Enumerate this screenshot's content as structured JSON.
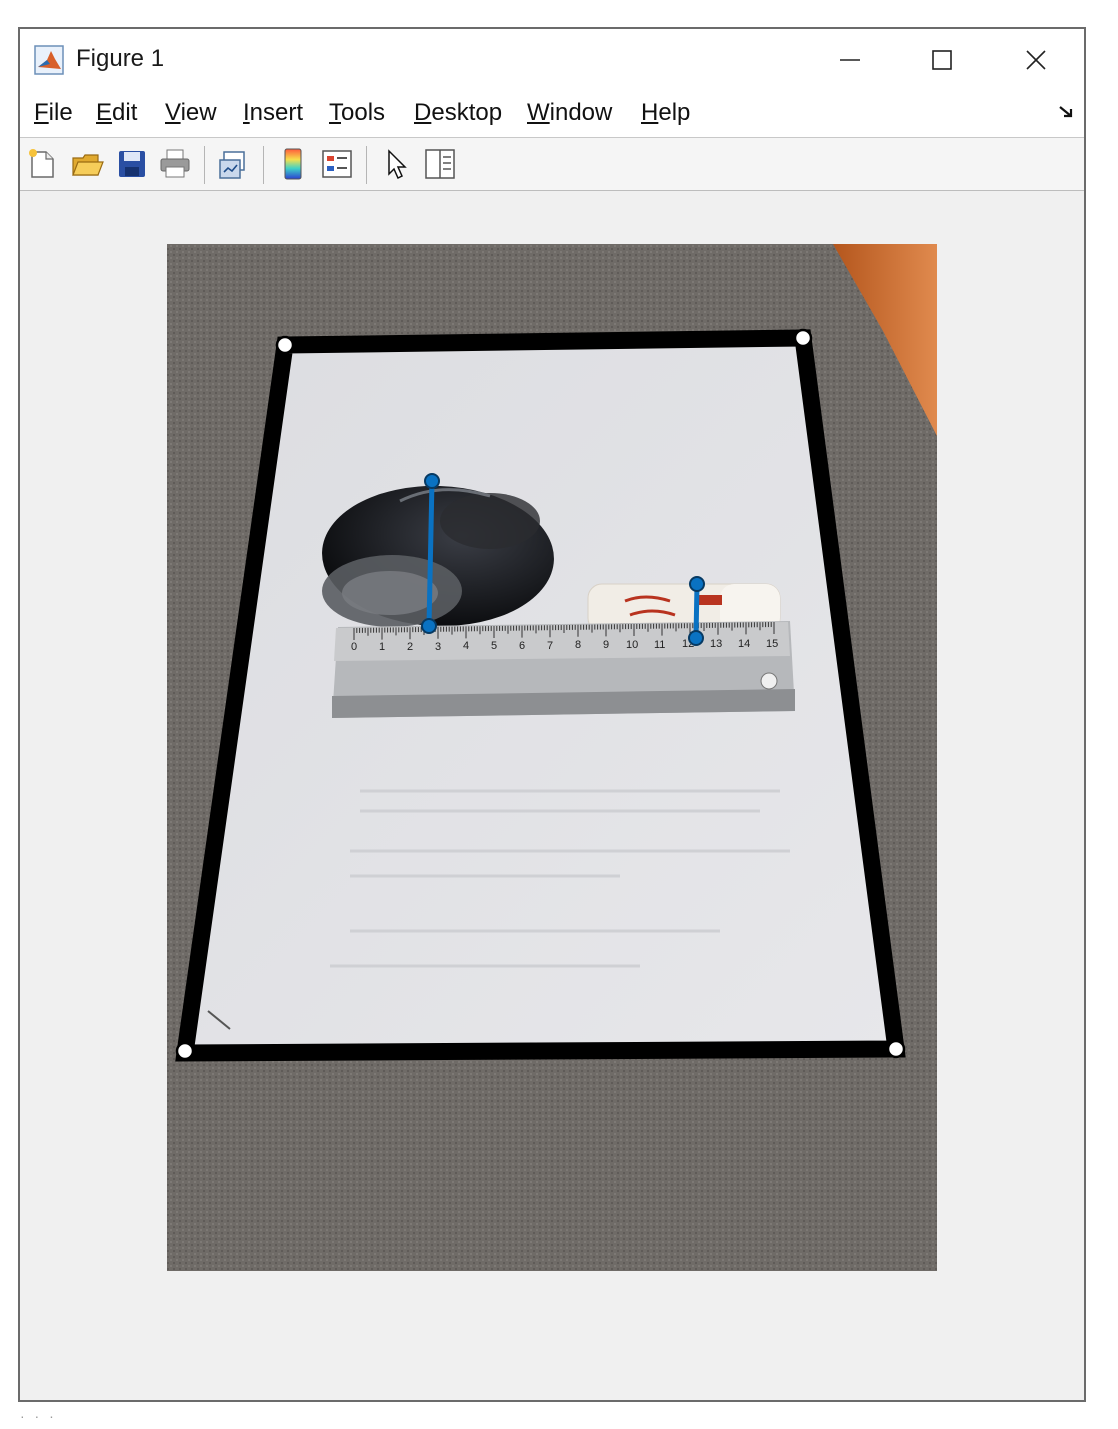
{
  "window": {
    "title": "Figure 1",
    "controls": {
      "minimize": "—",
      "maximize": "☐",
      "close": "✕"
    }
  },
  "menu": {
    "items": [
      {
        "label": "File",
        "mnemonic": "F",
        "rest": "ile"
      },
      {
        "label": "Edit",
        "mnemonic": "E",
        "rest": "dit"
      },
      {
        "label": "View",
        "mnemonic": "V",
        "rest": "iew"
      },
      {
        "label": "Insert",
        "mnemonic": "I",
        "rest": "nsert"
      },
      {
        "label": "Tools",
        "mnemonic": "T",
        "rest": "ools"
      },
      {
        "label": "Desktop",
        "mnemonic": "D",
        "rest": "esktop"
      },
      {
        "label": "Window",
        "mnemonic": "W",
        "rest": "indow"
      },
      {
        "label": "Help",
        "mnemonic": "H",
        "rest": "elp"
      }
    ],
    "dock_icon": "dock-figure-icon"
  },
  "toolbar": {
    "buttons": [
      "new-figure-icon",
      "open-file-icon",
      "save-icon",
      "print-icon",
      "link-plot-icon",
      "colorbar-icon",
      "legend-icon",
      "edit-plot-arrow-icon",
      "property-inspector-icon"
    ]
  },
  "ruler": {
    "tick_labels": [
      "0",
      "1",
      "2",
      "3",
      "4",
      "5",
      "6",
      "7",
      "8",
      "9",
      "10",
      "11",
      "12",
      "13",
      "14",
      "15"
    ]
  },
  "colors": {
    "measure_line": "#0a72c2",
    "handle_fill": "#0a72c2",
    "corner_handle": "#ffffff",
    "paper_outline": "#000000",
    "table": "#6e6a66",
    "paper": "#e6e7eb"
  },
  "status": {
    "text": "· · ·"
  }
}
